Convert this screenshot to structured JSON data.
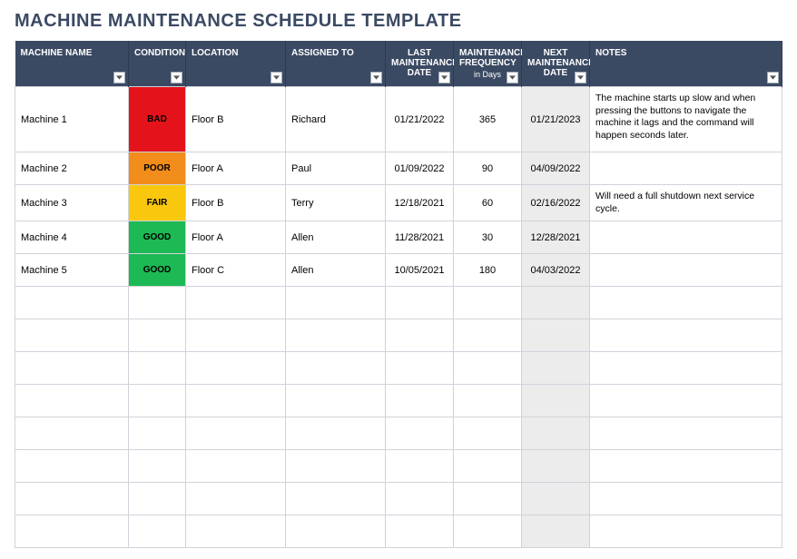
{
  "title": "MACHINE MAINTENANCE SCHEDULE TEMPLATE",
  "columns": [
    {
      "key": "machine_name",
      "label": "MACHINE NAME",
      "sub": "",
      "align": "left"
    },
    {
      "key": "condition",
      "label": "CONDITION",
      "sub": "",
      "align": "center"
    },
    {
      "key": "location",
      "label": "LOCATION",
      "sub": "",
      "align": "left"
    },
    {
      "key": "assigned_to",
      "label": "ASSIGNED TO",
      "sub": "",
      "align": "left"
    },
    {
      "key": "last_date",
      "label": "LAST MAINTENANCE DATE",
      "sub": "",
      "align": "center"
    },
    {
      "key": "frequency",
      "label": "MAINTENANCE FREQUENCY",
      "sub": "in Days",
      "align": "center"
    },
    {
      "key": "next_date",
      "label": "NEXT MAINTENANCE DATE",
      "sub": "",
      "align": "center"
    },
    {
      "key": "notes",
      "label": "NOTES",
      "sub": "",
      "align": "left"
    }
  ],
  "condition_colors": {
    "BAD": "#e4131b",
    "POOR": "#f28c1a",
    "FAIR": "#f9c80e",
    "GOOD": "#1db954"
  },
  "rows": [
    {
      "machine_name": "Machine 1",
      "condition": "BAD",
      "location": "Floor B",
      "assigned_to": "Richard",
      "last_date": "01/21/2022",
      "frequency": "365",
      "next_date": "01/21/2023",
      "notes": "The machine starts up slow and when pressing the buttons to navigate the machine it lags and the command will happen seconds later."
    },
    {
      "machine_name": "Machine 2",
      "condition": "POOR",
      "location": "Floor A",
      "assigned_to": "Paul",
      "last_date": "01/09/2022",
      "frequency": "90",
      "next_date": "04/09/2022",
      "notes": ""
    },
    {
      "machine_name": "Machine 3",
      "condition": "FAIR",
      "location": "Floor B",
      "assigned_to": "Terry",
      "last_date": "12/18/2021",
      "frequency": "60",
      "next_date": "02/16/2022",
      "notes": "Will need a full shutdown next service cycle."
    },
    {
      "machine_name": "Machine 4",
      "condition": "GOOD",
      "location": "Floor A",
      "assigned_to": "Allen",
      "last_date": "11/28/2021",
      "frequency": "30",
      "next_date": "12/28/2021",
      "notes": ""
    },
    {
      "machine_name": "Machine 5",
      "condition": "GOOD",
      "location": "Floor C",
      "assigned_to": "Allen",
      "last_date": "10/05/2021",
      "frequency": "180",
      "next_date": "04/03/2022",
      "notes": ""
    }
  ],
  "empty_rows": 8
}
